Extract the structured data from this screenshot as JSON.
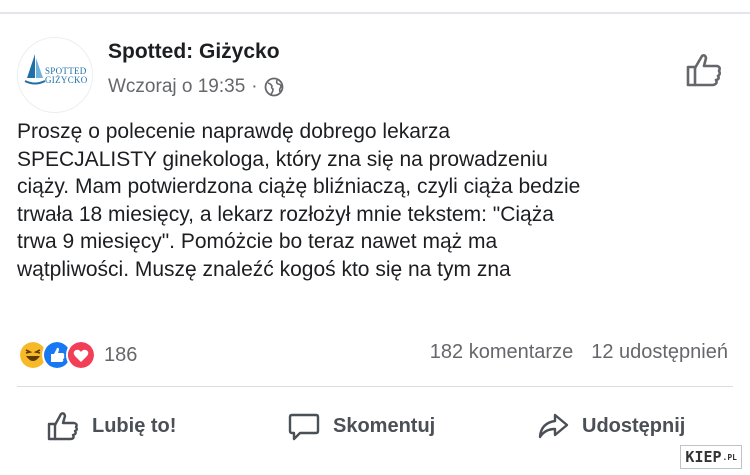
{
  "post": {
    "page_name": "Spotted: Giżycko",
    "timestamp": "Wczoraj o 19:35",
    "separator": "·",
    "avatar": {
      "line1": "SPOTTED",
      "line2": "GIŻYCKO",
      "icon": "sailboat-logo"
    },
    "text": "Proszę o polecenie naprawdę dobrego lekarza\nSPECJALISTY ginekologa, który zna się na prowadzeniu\nciąży. Mam potwierdzona ciążę bliźniaczą, czyli ciąża bedzie\ntrwała 18 miesięcy, a lekarz rozłożył mnie tekstem: \"Ciąża\ntrwa 9 miesięcy\". Pomóżcie bo teraz nawet mąż ma\nwątpliwości. Muszę znaleźć kogoś kto się na tym zna"
  },
  "reactions": {
    "icons": [
      "haha-icon",
      "like-icon",
      "love-icon"
    ],
    "count": "186"
  },
  "stats": {
    "comments": "182 komentarze",
    "shares": "12 udostępnień"
  },
  "actions": {
    "like": "Lubię to!",
    "comment": "Skomentuj",
    "share": "Udostępnij"
  },
  "watermark": {
    "text": "KIEP",
    "suffix": ".PL"
  },
  "colors": {
    "text": "#1c1e21",
    "secondary": "#65676b",
    "like_blue": "#1877f2",
    "love_red": "#f33e58",
    "haha_yellow": "#f7b928"
  }
}
